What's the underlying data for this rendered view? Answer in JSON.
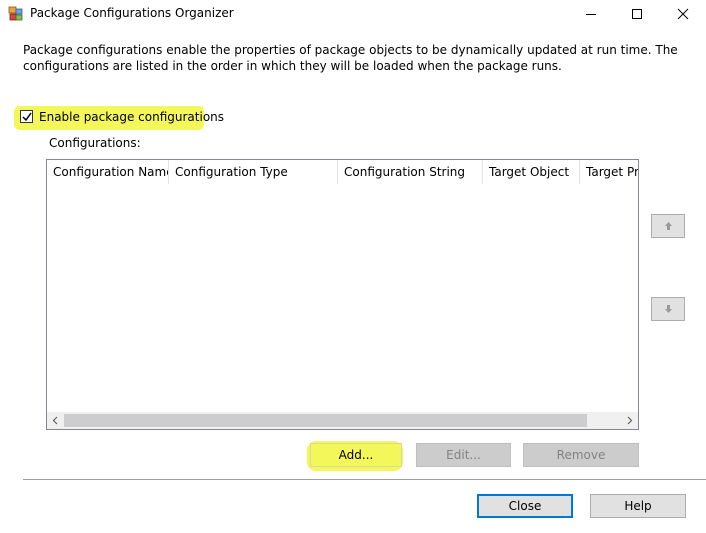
{
  "window": {
    "title": "Package Configurations Organizer",
    "icon": "ssis-package-icon"
  },
  "description": "Package configurations enable the properties of package objects to be dynamically updated at run time. The configurations are listed in the order in which they will be loaded when the package runs.",
  "enable_checkbox": {
    "label": "Enable package configurations",
    "checked": true
  },
  "configurations_label": "Configurations:",
  "table": {
    "columns": [
      "Configuration Name",
      "Configuration Type",
      "Configuration String",
      "Target Object",
      "Target Pro"
    ],
    "rows": []
  },
  "buttons": {
    "add": "Add...",
    "edit": "Edit...",
    "remove": "Remove",
    "close": "Close",
    "help": "Help"
  },
  "colors": {
    "highlight": "#f3f75a",
    "focus_border": "#0078d7"
  }
}
